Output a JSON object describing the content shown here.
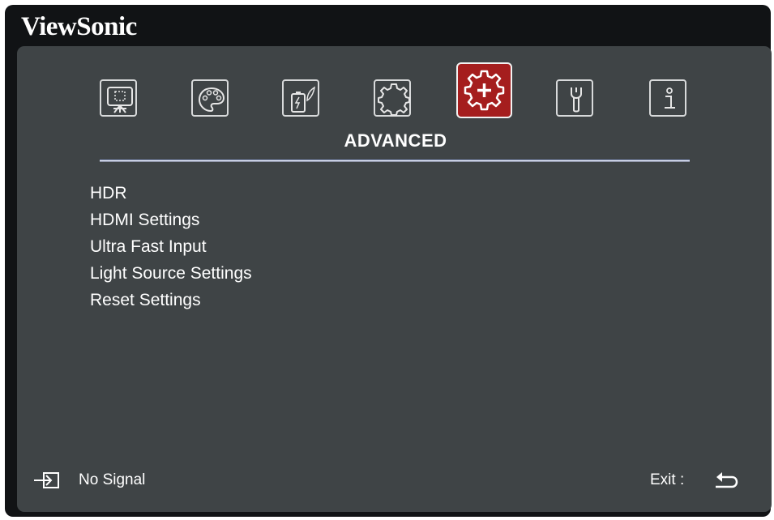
{
  "brand": "ViewSonic",
  "tabs": [
    {
      "id": "display",
      "icon": "display-icon",
      "active": false
    },
    {
      "id": "image",
      "icon": "palette-icon",
      "active": false
    },
    {
      "id": "power",
      "icon": "power-management-icon",
      "active": false
    },
    {
      "id": "basic",
      "icon": "gear-icon",
      "active": false
    },
    {
      "id": "advanced",
      "icon": "gear-plus-icon",
      "active": true
    },
    {
      "id": "system",
      "icon": "wrench-icon",
      "active": false
    },
    {
      "id": "information",
      "icon": "info-icon",
      "active": false
    }
  ],
  "active_tab_title": "ADVANCED",
  "menu_items": [
    "HDR",
    "HDMI Settings",
    "Ultra Fast Input",
    "Light Source Settings",
    "Reset Settings"
  ],
  "footer": {
    "input_icon": "input-source-icon",
    "status": "No Signal",
    "exit_label": "Exit :",
    "exit_icon": "return-arrow-icon"
  },
  "colors": {
    "frame": "#111315",
    "panel": "#3f4446",
    "active_tab": "#a51e1e",
    "text": "#ffffff"
  }
}
